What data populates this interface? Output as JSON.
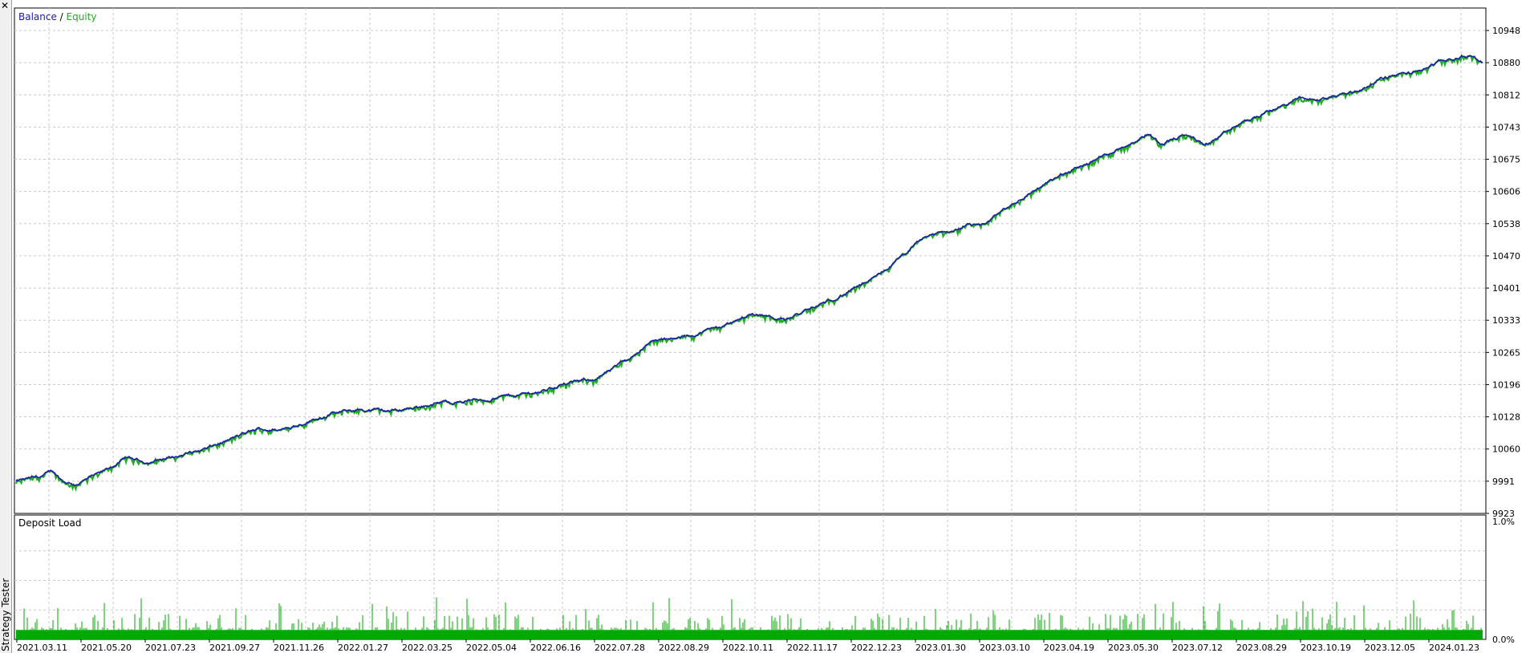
{
  "window": {
    "close_glyph": "✕",
    "side_title": "Strategy Tester"
  },
  "chart_data": [
    {
      "type": "line",
      "legend": {
        "placement": "top-left",
        "separator": " / "
      },
      "series": [
        {
          "name": "Balance",
          "color": "#1a1aa6"
        },
        {
          "name": "Equity",
          "color": "#22aa22"
        }
      ],
      "y_ticks": [
        "10948",
        "10880",
        "10812",
        "10743",
        "10675",
        "10606",
        "10538",
        "10470",
        "10401",
        "10333",
        "10265",
        "10196",
        "10128",
        "10060",
        "9991",
        "9923"
      ],
      "ylim": [
        9923,
        10948
      ],
      "grid": true,
      "anchor_points": [
        [
          0.0,
          9991
        ],
        [
          0.016,
          10000
        ],
        [
          0.025,
          10012
        ],
        [
          0.032,
          9992
        ],
        [
          0.04,
          9985
        ],
        [
          0.058,
          10008
        ],
        [
          0.075,
          10040
        ],
        [
          0.09,
          10032
        ],
        [
          0.11,
          10045
        ],
        [
          0.13,
          10060
        ],
        [
          0.15,
          10085
        ],
        [
          0.165,
          10102
        ],
        [
          0.18,
          10100
        ],
        [
          0.198,
          10118
        ],
        [
          0.215,
          10135
        ],
        [
          0.235,
          10143
        ],
        [
          0.255,
          10140
        ],
        [
          0.265,
          10145
        ],
        [
          0.275,
          10150
        ],
        [
          0.29,
          10158
        ],
        [
          0.305,
          10162
        ],
        [
          0.32,
          10165
        ],
        [
          0.34,
          10175
        ],
        [
          0.355,
          10180
        ],
        [
          0.37,
          10195
        ],
        [
          0.385,
          10203
        ],
        [
          0.395,
          10210
        ],
        [
          0.408,
          10230
        ],
        [
          0.425,
          10270
        ],
        [
          0.435,
          10290
        ],
        [
          0.45,
          10292
        ],
        [
          0.47,
          10310
        ],
        [
          0.49,
          10330
        ],
        [
          0.5,
          10345
        ],
        [
          0.51,
          10345
        ],
        [
          0.525,
          10335
        ],
        [
          0.545,
          10360
        ],
        [
          0.565,
          10390
        ],
        [
          0.585,
          10420
        ],
        [
          0.605,
          10470
        ],
        [
          0.62,
          10510
        ],
        [
          0.64,
          10525
        ],
        [
          0.65,
          10535
        ],
        [
          0.658,
          10530
        ],
        [
          0.67,
          10560
        ],
        [
          0.685,
          10590
        ],
        [
          0.7,
          10620
        ],
        [
          0.72,
          10650
        ],
        [
          0.74,
          10680
        ],
        [
          0.76,
          10710
        ],
        [
          0.772,
          10730
        ],
        [
          0.78,
          10710
        ],
        [
          0.79,
          10720
        ],
        [
          0.8,
          10725
        ],
        [
          0.81,
          10705
        ],
        [
          0.82,
          10720
        ],
        [
          0.835,
          10750
        ],
        [
          0.85,
          10770
        ],
        [
          0.865,
          10790
        ],
        [
          0.875,
          10805
        ],
        [
          0.887,
          10800
        ],
        [
          0.9,
          10810
        ],
        [
          0.915,
          10820
        ],
        [
          0.93,
          10845
        ],
        [
          0.945,
          10855
        ],
        [
          0.955,
          10860
        ],
        [
          0.97,
          10880
        ],
        [
          0.985,
          10892
        ],
        [
          0.993,
          10894
        ],
        [
          1.0,
          10880
        ]
      ]
    },
    {
      "type": "bar",
      "title": "Deposit Load",
      "color": "#00aa00",
      "y_ticks": [
        "1.0%",
        "0.0%"
      ],
      "ylim": [
        0,
        1.0
      ],
      "base_level_pct": 0.08,
      "note": "Approximately 800 green spikes"
    }
  ],
  "x_axis": {
    "dates": [
      "2021.03.11",
      "2021.05.20",
      "2021.07.23",
      "2021.09.27",
      "2021.11.26",
      "2022.01.27",
      "2022.03.25",
      "2022.05.04",
      "2022.06.16",
      "2022.07.28",
      "2022.08.29",
      "2022.10.11",
      "2022.11.17",
      "2022.12.23",
      "2023.01.30",
      "2023.03.10",
      "2023.04.19",
      "2023.05.30",
      "2023.07.12",
      "2023.08.29",
      "2023.10.19",
      "2023.12.05",
      "2024.01.23"
    ]
  }
}
